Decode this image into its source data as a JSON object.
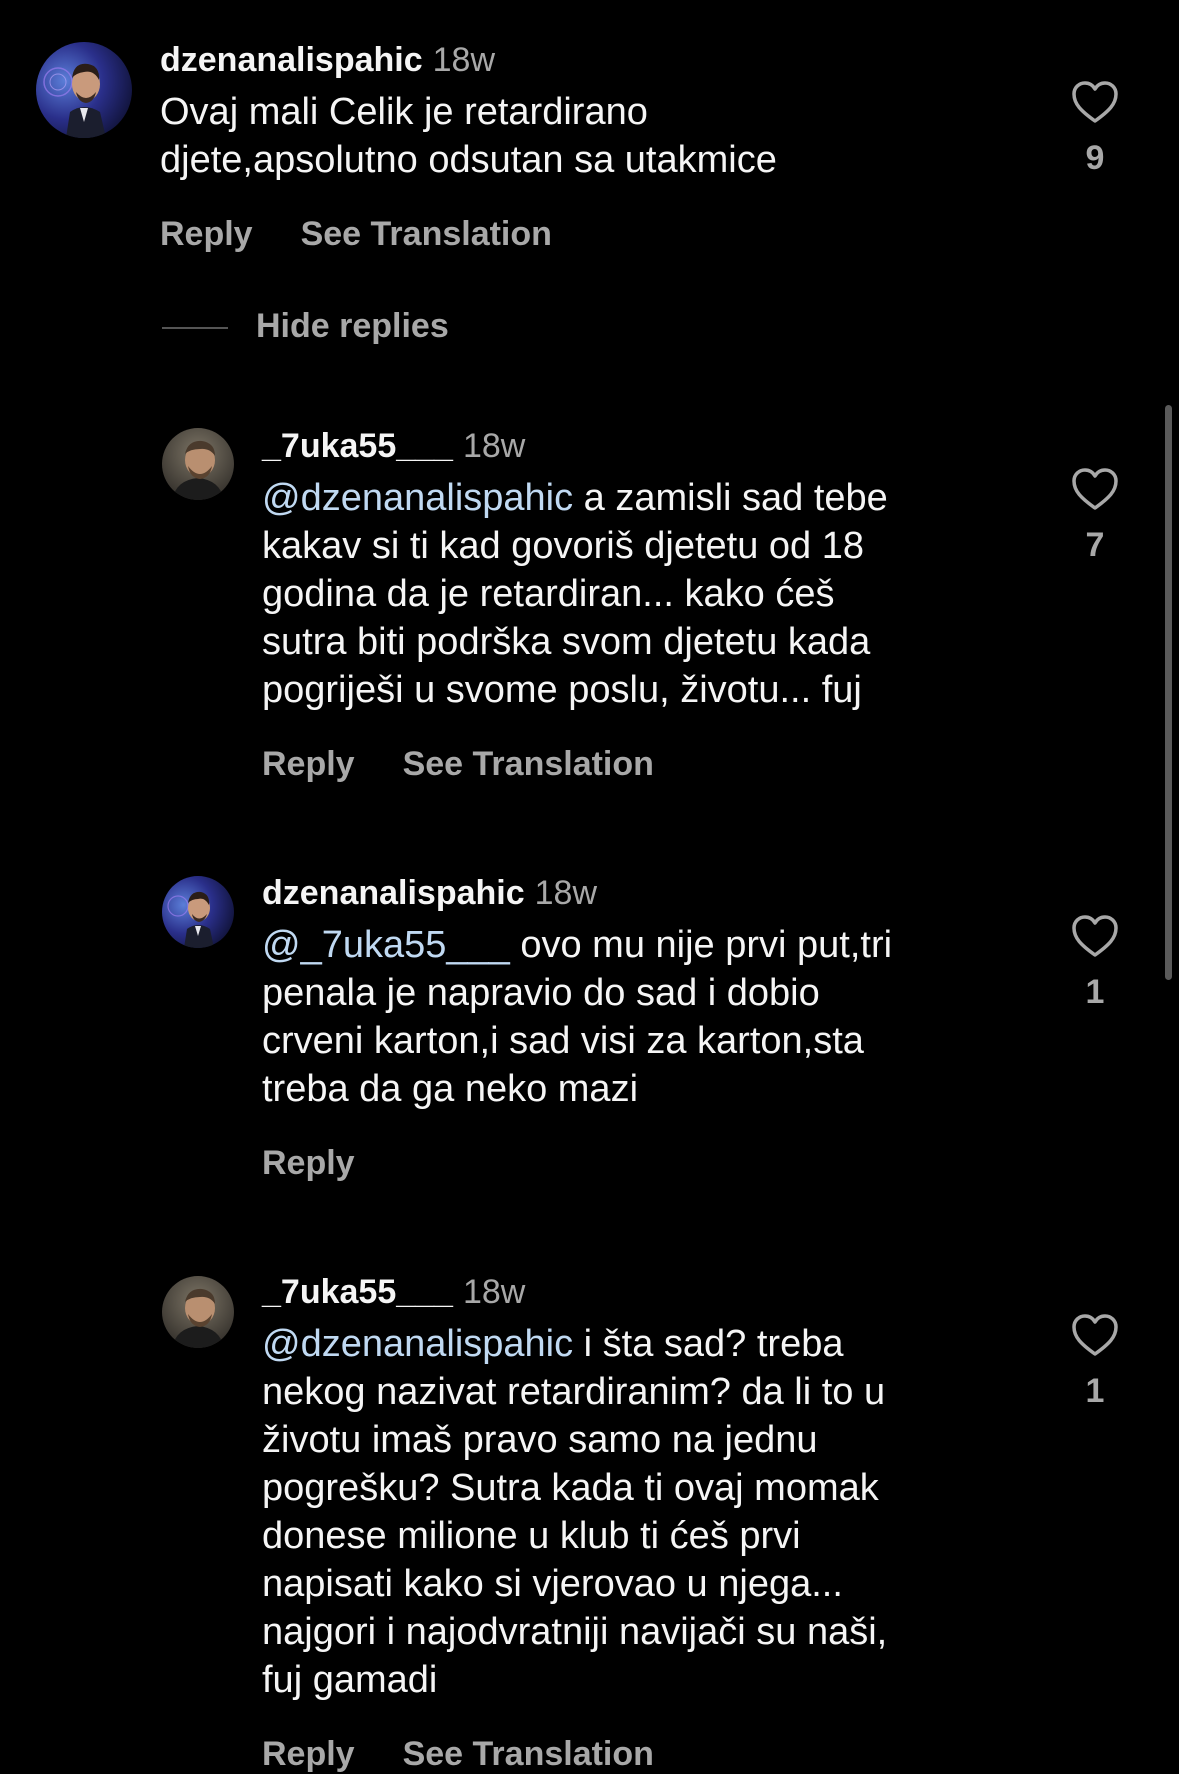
{
  "top_comment": {
    "username": "dzenanalispahic",
    "time": "18w",
    "lines": [
      "Ovaj mali Celik je retardirano",
      "djete,apsolutno odsutan sa utakmice"
    ],
    "likes": "9",
    "reply_label": "Reply",
    "translate_label": "See Translation"
  },
  "hide_replies_label": "Hide replies",
  "replies": [
    {
      "username": "_7uka55___",
      "time": "18w",
      "mention": "@dzenanalispahic",
      "first_line": " a zamisli sad tebe",
      "lines": [
        "kakav si ti kad govoriš djetetu od 18",
        "godina da je retardiran... kako ćeš",
        "sutra biti podrška svom djetetu kada",
        "pogriješi u svome poslu, životu... fuj"
      ],
      "likes": "7",
      "reply_label": "Reply",
      "translate_label": "See Translation"
    },
    {
      "username": "dzenanalispahic",
      "time": "18w",
      "mention": "@_7uka55___",
      "first_line": " ovo mu nije prvi put,tri",
      "lines": [
        "penala je napravio do sad i dobio",
        "crveni karton,i sad visi za karton,sta",
        "treba da ga neko mazi"
      ],
      "likes": "1",
      "reply_label": "Reply"
    },
    {
      "username": "_7uka55___",
      "time": "18w",
      "mention": "@dzenanalispahic",
      "first_line": " i šta sad? treba",
      "lines": [
        "nekog nazivat retardiranim? da li to u",
        "životu imaš pravo samo na jednu",
        "pogrešku? Sutra kada ti ovaj momak",
        "donese milione u klub ti ćeš prvi",
        "napisati kako si vjerovao u njega...",
        "najgori i najodvratniji navijači su naši,",
        "fuj gamadi"
      ],
      "likes": "1",
      "reply_label": "Reply",
      "translate_label": "See Translation"
    }
  ],
  "icons": {
    "like": "heart-outline-icon"
  },
  "colors": {
    "background": "#000000",
    "text": "#f5f5f5",
    "secondary": "#a8a8a8",
    "mention": "#c0d9f2"
  }
}
